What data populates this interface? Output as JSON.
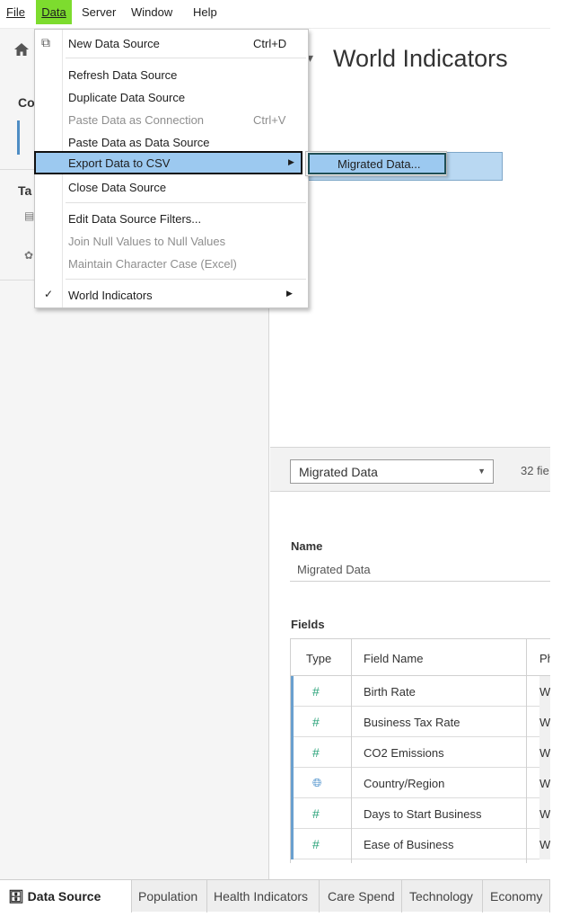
{
  "menubar": {
    "items": [
      "File",
      "Data",
      "Server",
      "Window",
      "Help"
    ]
  },
  "left_panel": {
    "connections_label": "Co",
    "tables_label": "Ta"
  },
  "datasource": {
    "title": "World Indicators"
  },
  "data_menu": {
    "items": [
      {
        "label": "New Data Source",
        "shortcut": "Ctrl+D"
      },
      {
        "label": "Refresh Data Source"
      },
      {
        "label": "Duplicate Data Source"
      },
      {
        "label": "Paste Data as Connection",
        "shortcut": "Ctrl+V"
      },
      {
        "label": "Paste Data as Data Source"
      },
      {
        "label": "Export Data to CSV"
      },
      {
        "label": "Close Data Source"
      },
      {
        "label": "Edit Data Source Filters..."
      },
      {
        "label": "Join Null Values to Null Values"
      },
      {
        "label": "Maintain Character Case (Excel)"
      },
      {
        "label": "World Indicators"
      }
    ],
    "submenu_item": "Migrated Data..."
  },
  "metadata": {
    "select_value": "Migrated Data",
    "fields_count": "32 fie",
    "name_label": "Name",
    "name_value": "Migrated Data",
    "fields_label": "Fields",
    "columns": [
      "Type",
      "Field Name",
      "Ph"
    ],
    "rows": [
      {
        "type": "#",
        "name": "Birth Rate",
        "phys": "W"
      },
      {
        "type": "#",
        "name": "Business Tax Rate",
        "phys": "W"
      },
      {
        "type": "#",
        "name": "CO2 Emissions",
        "phys": "W"
      },
      {
        "type": "globe",
        "name": "Country/Region",
        "phys": "W"
      },
      {
        "type": "#",
        "name": "Days to Start Business",
        "phys": "W"
      },
      {
        "type": "#",
        "name": "Ease of Business",
        "phys": "W"
      }
    ]
  },
  "tabs": [
    "Data Source",
    "Population",
    "Health Indicators",
    "Care Spend",
    "Technology",
    "Economy"
  ],
  "colors": {
    "menu_active": "#7ddc2e",
    "highlight": "#9cc9f0",
    "number_icon": "#2aa37a",
    "geo_icon": "#3a85c6"
  }
}
